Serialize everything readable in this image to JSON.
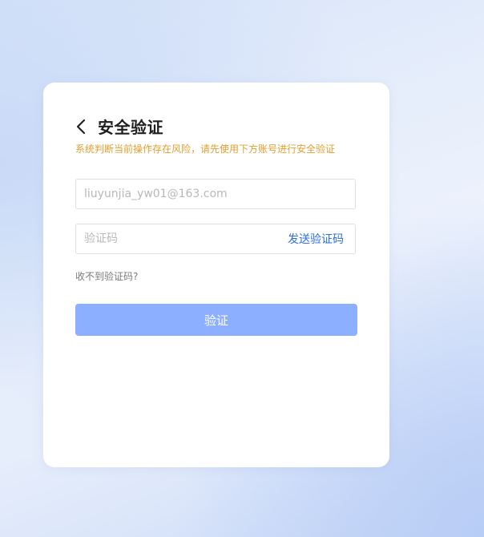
{
  "header": {
    "back_icon": "chevron-left-icon",
    "title": "安全验证"
  },
  "warning_text": "系统判断当前操作存在风险，请先使用下方账号进行安全验证",
  "account_field": {
    "placeholder": "liuyunjia_yw01@163.com",
    "value": ""
  },
  "code_field": {
    "placeholder": "验证码",
    "value": "",
    "send_label": "发送验证码"
  },
  "no_code_link": "收不到验证码?",
  "verify_button": "验证",
  "colors": {
    "warning": "#e0a030",
    "link": "#2f6ee0",
    "button_bg": "#8cb0ff",
    "title": "#1f1f1f"
  }
}
